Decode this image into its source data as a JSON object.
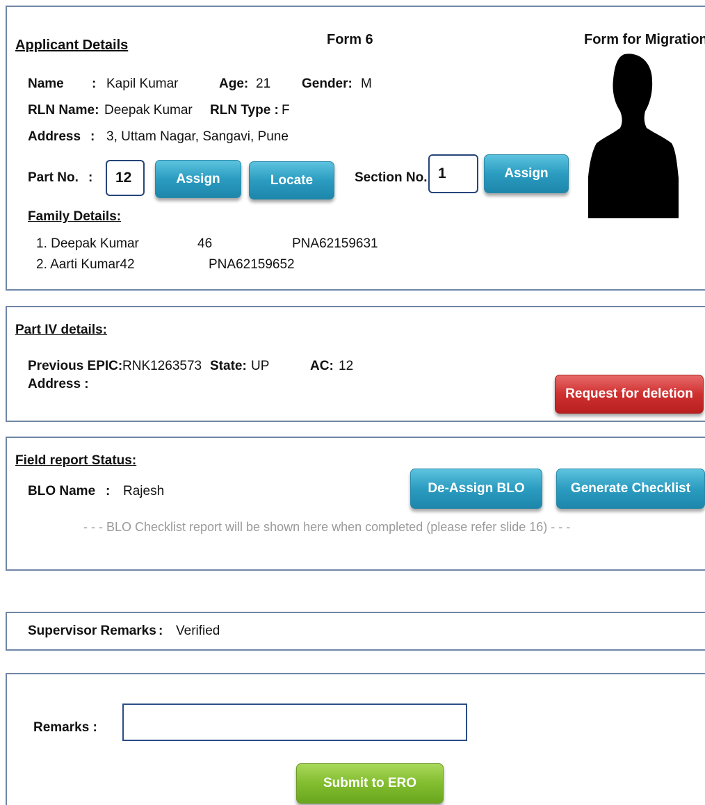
{
  "applicant": {
    "section_title": "Applicant Details",
    "form_title": "Form 6",
    "migration_title": "Form for Migration",
    "name_label": "Name",
    "colon": ":",
    "name_value": "Kapil Kumar",
    "age_label": "Age:",
    "age_value": "21",
    "gender_label": "Gender:",
    "gender_value": "M",
    "rln_name_label": "RLN Name:",
    "rln_name_value": "Deepak Kumar",
    "rln_type_label": "RLN Type :",
    "rln_type_value": "F",
    "address_label": "Address",
    "address_value": "3, Uttam Nagar, Sangavi, Pune",
    "part_no_label": "Part No.",
    "part_no_value": "12",
    "assign_label": "Assign",
    "locate_label": "Locate",
    "section_no_label": "Section No.",
    "section_no_value": "1",
    "assign2_label": "Assign",
    "family_title": "Family Details:",
    "family": [
      {
        "name": "1. Deepak Kumar",
        "age": "46",
        "epic": "PNA62159631"
      },
      {
        "name": "2. Aarti Kumar42",
        "age": "",
        "epic": "PNA62159652"
      }
    ],
    "photo_icon": "person-silhouette-icon"
  },
  "part4": {
    "title": "Part IV details:",
    "prev_epic_label": "Previous EPIC:",
    "prev_epic_value": "RNK1263573",
    "state_label": "State:",
    "state_value": "UP",
    "ac_label": "AC:",
    "ac_value": "12",
    "address_label": "Address :",
    "delete_button": "Request for deletion"
  },
  "field_report": {
    "title": "Field report Status:",
    "blo_label": "BLO Name",
    "colon": ":",
    "blo_value": "Rajesh",
    "deassign_button": "De-Assign BLO",
    "checklist_button": "Generate Checklist",
    "note": "- - - BLO Checklist report will be shown here when completed (please refer slide 16) - - -"
  },
  "supervisor": {
    "label": "Supervisor Remarks",
    "colon": ":",
    "value": "Verified"
  },
  "remarks": {
    "label": "Remarks :",
    "value": "",
    "submit_button": "Submit to ERO"
  },
  "colors": {
    "panel_border": "#6f86a6",
    "blue_button": "#2b9cc0",
    "red_button": "#cf3030",
    "green_button": "#82bd2f",
    "input_border": "#26457a"
  }
}
